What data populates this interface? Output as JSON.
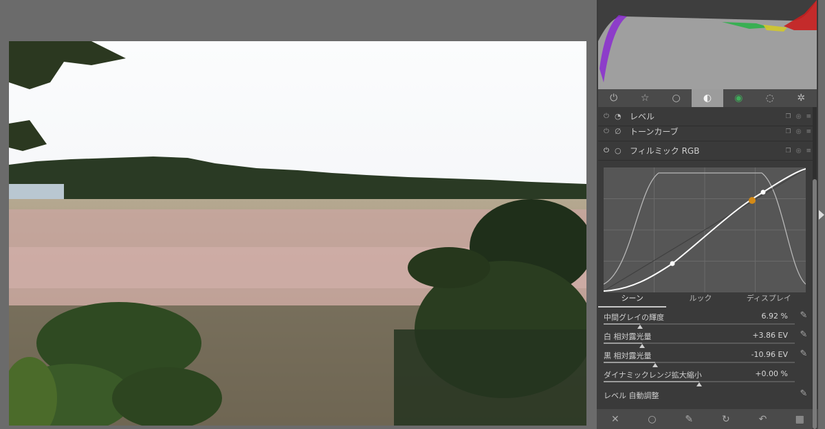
{
  "colors": {
    "accent_orange": "#d48a16",
    "panel_bg": "#3a3a3a",
    "tab_active": "#9c9c9c",
    "canvas_bg": "#6b6b6b"
  },
  "module_groups": [
    {
      "icon": "power-icon",
      "glyph": "⏻"
    },
    {
      "icon": "star-icon",
      "glyph": "☆"
    },
    {
      "icon": "circle-icon",
      "glyph": "○"
    },
    {
      "icon": "tone-icon",
      "glyph": "◐"
    },
    {
      "icon": "color-icon",
      "glyph": "◉"
    },
    {
      "icon": "correct-icon",
      "glyph": "◌"
    },
    {
      "icon": "effect-icon",
      "glyph": "✲"
    }
  ],
  "modules": [
    {
      "name": "レベル",
      "enabled": false
    },
    {
      "name": "トーンカーブ",
      "enabled": false
    },
    {
      "name": "フィルミック RGB",
      "enabled": true
    }
  ],
  "filmic": {
    "subtabs": [
      "シーン",
      "ルック",
      "ディスプレイ"
    ],
    "sliders": [
      {
        "label": "中間グレイの輝度",
        "value": "6.92 %",
        "pos": 0.19
      },
      {
        "label": "白 相対露光量",
        "value": "+3.86 EV",
        "pos": 0.2
      },
      {
        "label": "黒 相対露光量",
        "value": "-10.96 EV",
        "pos": 0.27
      },
      {
        "label": "ダイナミックレンジ拡大縮小",
        "value": "+0.00 %",
        "pos": 0.5
      }
    ],
    "auto_label": "レベル 自動調整"
  },
  "bottombar": [
    {
      "icon": "reset-icon",
      "glyph": "✕"
    },
    {
      "icon": "circle-icon",
      "glyph": "○"
    },
    {
      "icon": "pen-icon",
      "glyph": "✎"
    },
    {
      "icon": "refresh-icon",
      "glyph": "↻"
    },
    {
      "icon": "undo-icon",
      "glyph": "↶"
    },
    {
      "icon": "checker-icon",
      "glyph": "▦"
    }
  ]
}
